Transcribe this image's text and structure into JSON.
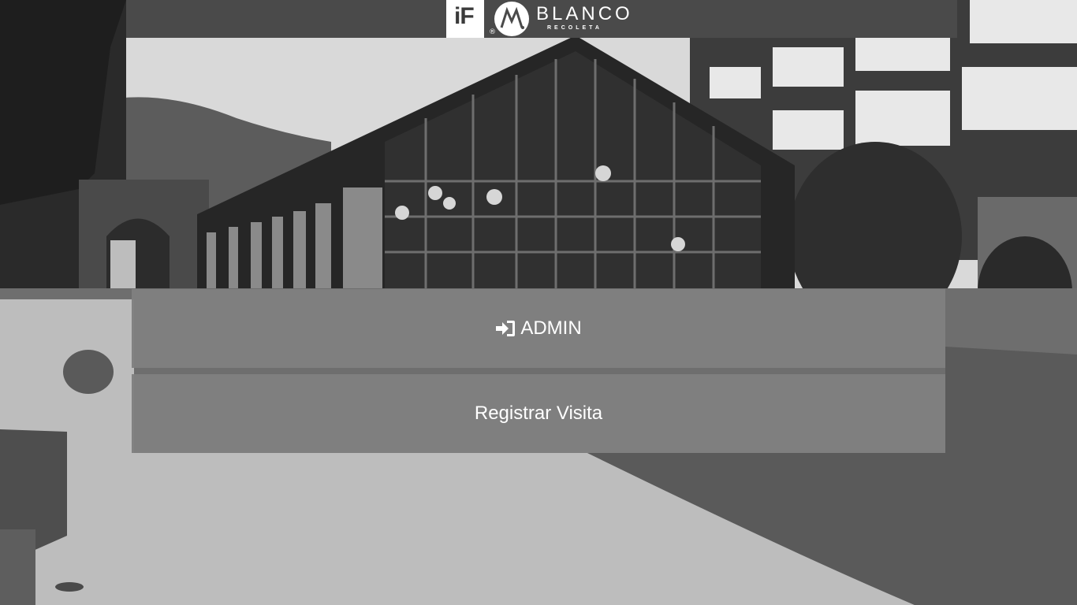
{
  "header": {
    "logo_if": "iF",
    "logo_registered": "®",
    "brand_name": "BLANCO",
    "brand_sub": "RECOLETA"
  },
  "buttons": {
    "admin_label": "ADMIN",
    "admin_icon": "sign-in-icon",
    "visit_label": "Registrar Visita"
  },
  "colors": {
    "topbar": "#4a4a4a",
    "button_bg": "#808080",
    "button_text": "#ffffff"
  }
}
